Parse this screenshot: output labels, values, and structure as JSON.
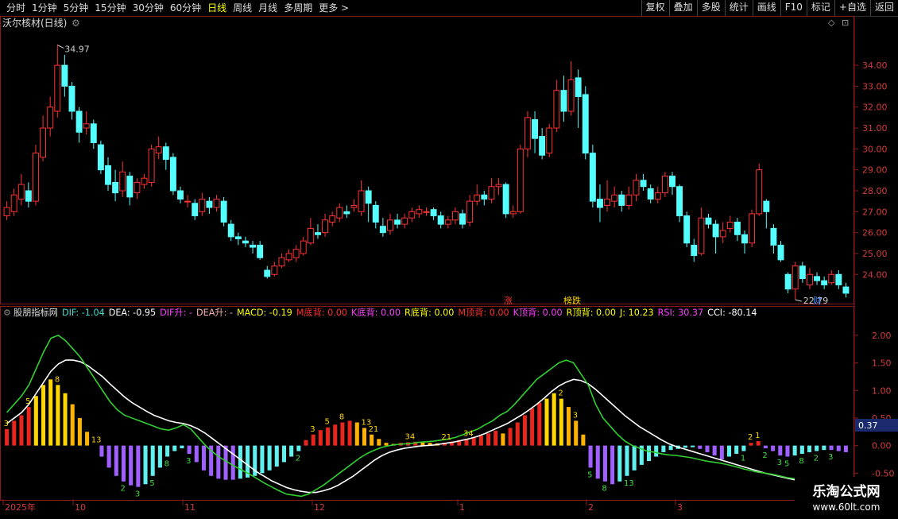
{
  "toolbar": {
    "periods": [
      "分时",
      "1分钟",
      "5分钟",
      "15分钟",
      "30分钟",
      "60分钟",
      "日线",
      "周线",
      "月线",
      "多周期",
      "更多 >"
    ],
    "active_period": "日线",
    "buttons": [
      "复权",
      "叠加",
      "多股",
      "统计",
      "画线",
      "F10",
      "标记",
      "+自选",
      "返回"
    ]
  },
  "stock": {
    "title": "沃尔核材(日线)",
    "high_label": "34.97",
    "low_label": "22.79",
    "markers": {
      "zhang": "涨",
      "bangdie": "榜跌",
      "cai": "财"
    }
  },
  "indicator": {
    "name": "股朋指标网",
    "values": [
      {
        "text": "DIF: -1.04",
        "color": "#40e0d0"
      },
      {
        "text": "DEA: -0.95",
        "color": "#ffffff"
      },
      {
        "text": "DIF升: -",
        "color": "#ff40ff"
      },
      {
        "text": "DEA升: -",
        "color": "#ffb0b0"
      },
      {
        "text": "MACD: -0.19",
        "color": "#ffff00"
      },
      {
        "text": "M底背: 0.00",
        "color": "#ff3030"
      },
      {
        "text": "K底背: 0.00",
        "color": "#ff40ff"
      },
      {
        "text": "R底背: 0.00",
        "color": "#ffff00"
      },
      {
        "text": "M顶背: 0.00",
        "color": "#ff3030"
      },
      {
        "text": "K顶背: 0.00",
        "color": "#ff40ff"
      },
      {
        "text": "R顶背: 0.00",
        "color": "#ffff00"
      },
      {
        "text": "J: 10.23",
        "color": "#ffff00"
      },
      {
        "text": "RSI: 30.37",
        "color": "#ff40ff"
      },
      {
        "text": "CCI: -80.14",
        "color": "#ffffff"
      }
    ],
    "current_value": "0.37"
  },
  "chart_data": [
    {
      "type": "candlestick",
      "title": "沃尔核材(日线)",
      "y_ticks": [
        24.0,
        25.0,
        26.0,
        27.0,
        28.0,
        29.0,
        30.0,
        31.0,
        32.0,
        33.0,
        34.0
      ],
      "ylim": [
        22.3,
        35.6
      ],
      "annotations": [
        "34.97",
        "22.79"
      ],
      "candles": [
        [
          26.8,
          27.2,
          27.5,
          26.6
        ],
        [
          27.0,
          27.8,
          28.1,
          26.8
        ],
        [
          27.6,
          28.3,
          28.8,
          27.3
        ],
        [
          28.0,
          27.5,
          28.4,
          27.2
        ],
        [
          27.5,
          29.8,
          30.2,
          27.3
        ],
        [
          29.6,
          31.0,
          31.6,
          29.4
        ],
        [
          31.0,
          32.0,
          32.5,
          30.6
        ],
        [
          31.8,
          34.0,
          34.97,
          31.5
        ],
        [
          34.0,
          33.0,
          34.5,
          32.5
        ],
        [
          33.0,
          31.8,
          33.2,
          31.4
        ],
        [
          31.8,
          30.8,
          32.0,
          30.3
        ],
        [
          31.0,
          31.2,
          31.8,
          30.7
        ],
        [
          31.2,
          30.3,
          31.4,
          30.0
        ],
        [
          30.2,
          29.0,
          30.4,
          28.8
        ],
        [
          29.2,
          28.3,
          29.6,
          28.0
        ],
        [
          28.4,
          27.9,
          29.0,
          27.5
        ],
        [
          28.0,
          28.9,
          29.4,
          27.7
        ],
        [
          28.7,
          27.7,
          28.9,
          27.3
        ],
        [
          27.9,
          28.4,
          28.6,
          27.6
        ],
        [
          28.3,
          28.6,
          28.8,
          28.1
        ],
        [
          28.4,
          30.0,
          30.2,
          28.2
        ],
        [
          29.8,
          30.1,
          30.6,
          29.5
        ],
        [
          30.1,
          29.5,
          30.3,
          29.0
        ],
        [
          29.6,
          28.0,
          29.8,
          27.8
        ],
        [
          28.0,
          27.6,
          28.2,
          27.4
        ],
        [
          27.5,
          27.5,
          27.8,
          27.2
        ],
        [
          27.4,
          26.8,
          27.6,
          26.6
        ],
        [
          27.0,
          27.6,
          27.9,
          26.8
        ],
        [
          27.5,
          27.2,
          27.7,
          26.9
        ],
        [
          27.2,
          27.6,
          27.8,
          27.0
        ],
        [
          27.5,
          26.5,
          27.7,
          26.3
        ],
        [
          26.4,
          25.8,
          26.6,
          25.6
        ],
        [
          25.8,
          25.7,
          26.0,
          25.4
        ],
        [
          25.6,
          25.5,
          25.8,
          25.3
        ],
        [
          25.4,
          25.3,
          25.6,
          25.0
        ],
        [
          25.4,
          24.8,
          25.6,
          24.7
        ],
        [
          24.2,
          23.9,
          24.4,
          23.8
        ],
        [
          24.0,
          24.4,
          24.6,
          23.9
        ],
        [
          24.4,
          24.8,
          25.0,
          24.3
        ],
        [
          24.7,
          25.0,
          25.2,
          24.6
        ],
        [
          24.8,
          25.2,
          25.4,
          24.6
        ],
        [
          25.0,
          25.6,
          25.8,
          24.9
        ],
        [
          25.5,
          26.2,
          26.7,
          25.4
        ],
        [
          26.0,
          25.9,
          26.4,
          25.7
        ],
        [
          26.0,
          26.6,
          26.9,
          25.8
        ],
        [
          26.5,
          26.8,
          27.0,
          26.3
        ],
        [
          26.7,
          27.2,
          27.4,
          26.5
        ],
        [
          27.0,
          26.9,
          27.3,
          26.7
        ],
        [
          27.2,
          27.3,
          27.6,
          27.0
        ],
        [
          27.0,
          28.0,
          28.5,
          26.8
        ],
        [
          28.0,
          27.4,
          28.2,
          26.5
        ],
        [
          27.3,
          26.5,
          27.5,
          26.2
        ],
        [
          26.3,
          26.0,
          26.7,
          25.8
        ],
        [
          26.1,
          26.6,
          26.9,
          25.9
        ],
        [
          26.6,
          26.4,
          26.9,
          26.2
        ],
        [
          26.4,
          26.7,
          26.9,
          26.2
        ],
        [
          26.7,
          27.0,
          27.2,
          26.5
        ],
        [
          26.9,
          27.1,
          27.3,
          26.7
        ],
        [
          27.0,
          27.0,
          27.2,
          26.8
        ],
        [
          27.1,
          26.8,
          27.2,
          26.6
        ],
        [
          26.8,
          26.4,
          27.0,
          26.2
        ],
        [
          26.4,
          26.6,
          26.8,
          26.2
        ],
        [
          26.6,
          27.0,
          27.2,
          26.4
        ],
        [
          26.9,
          26.4,
          27.1,
          26.2
        ],
        [
          26.5,
          27.5,
          27.8,
          26.3
        ],
        [
          27.5,
          27.8,
          28.3,
          27.3
        ],
        [
          27.8,
          27.6,
          28.0,
          27.3
        ],
        [
          27.6,
          28.2,
          28.6,
          27.4
        ],
        [
          28.2,
          28.3,
          28.6,
          27.8
        ],
        [
          28.3,
          26.9,
          28.4,
          26.7
        ],
        [
          26.9,
          27.0,
          27.3,
          26.7
        ],
        [
          27.0,
          30.0,
          30.2,
          26.9
        ],
        [
          30.0,
          31.5,
          31.8,
          29.6
        ],
        [
          31.4,
          30.5,
          31.8,
          29.8
        ],
        [
          30.6,
          29.7,
          31.0,
          29.5
        ],
        [
          29.8,
          31.0,
          31.2,
          29.6
        ],
        [
          31.0,
          32.8,
          33.3,
          30.8
        ],
        [
          32.8,
          31.8,
          33.5,
          31.3
        ],
        [
          31.8,
          33.3,
          34.2,
          31.6
        ],
        [
          33.4,
          32.5,
          33.8,
          31.0
        ],
        [
          32.6,
          29.8,
          33.0,
          29.5
        ],
        [
          29.8,
          27.5,
          30.2,
          27.2
        ],
        [
          27.6,
          27.2,
          28.3,
          26.5
        ],
        [
          27.3,
          27.6,
          28.5,
          27.0
        ],
        [
          27.5,
          27.8,
          28.2,
          27.2
        ],
        [
          27.8,
          27.3,
          28.0,
          27.0
        ],
        [
          27.3,
          27.8,
          28.2,
          27.1
        ],
        [
          27.8,
          28.5,
          28.8,
          27.5
        ],
        [
          28.5,
          28.2,
          28.8,
          28.0
        ],
        [
          28.1,
          27.6,
          28.3,
          27.4
        ],
        [
          27.6,
          27.9,
          28.2,
          27.4
        ],
        [
          27.9,
          28.7,
          28.9,
          27.7
        ],
        [
          28.7,
          28.2,
          28.9,
          27.8
        ],
        [
          28.2,
          26.8,
          28.3,
          26.5
        ],
        [
          26.8,
          25.5,
          27.0,
          25.3
        ],
        [
          25.4,
          24.9,
          25.7,
          24.6
        ],
        [
          25.0,
          26.7,
          27.2,
          24.9
        ],
        [
          26.7,
          26.4,
          26.9,
          26.2
        ],
        [
          26.4,
          25.8,
          26.6,
          25.0
        ],
        [
          25.8,
          26.1,
          26.5,
          25.5
        ],
        [
          26.2,
          26.5,
          26.8,
          26.0
        ],
        [
          26.5,
          25.9,
          26.7,
          25.6
        ],
        [
          25.9,
          25.5,
          26.1,
          25.0
        ],
        [
          25.5,
          26.9,
          27.1,
          25.3
        ],
        [
          26.9,
          29.0,
          29.3,
          26.8
        ],
        [
          27.5,
          27.0,
          27.6,
          26.2
        ],
        [
          26.2,
          25.4,
          26.4,
          25.0
        ],
        [
          25.4,
          24.7,
          25.6,
          24.6
        ],
        [
          24.0,
          23.3,
          24.1,
          23.1
        ],
        [
          23.3,
          24.4,
          24.6,
          22.79
        ],
        [
          24.4,
          23.8,
          24.6,
          23.6
        ],
        [
          23.5,
          24.0,
          24.3,
          23.3
        ],
        [
          23.9,
          23.7,
          24.1,
          23.5
        ],
        [
          23.7,
          23.5,
          23.9,
          23.3
        ],
        [
          23.6,
          24.0,
          24.2,
          23.5
        ],
        [
          24.0,
          23.5,
          24.2,
          23.3
        ],
        [
          23.4,
          23.1,
          23.6,
          22.9
        ]
      ]
    },
    {
      "type": "macd",
      "title": "股朋指标网",
      "y_ticks": [
        2.0,
        1.5,
        1.0,
        0.5,
        0.0,
        -0.5
      ],
      "ylim": [
        -1.0,
        2.2
      ],
      "x_labels": [
        "2025年",
        "10",
        "11",
        "12",
        "1",
        "2",
        "3"
      ],
      "histogram_labels": [
        "3",
        "5",
        "8",
        "13",
        "2",
        "3",
        "5",
        "8",
        "3",
        "21",
        "34",
        "2",
        "3",
        "5",
        "8",
        "13",
        "21",
        "34",
        "2",
        "3",
        "5",
        "8",
        "13",
        "1",
        "2",
        "1",
        "2",
        "3",
        "5",
        "8",
        "2",
        "3"
      ],
      "hist": [
        0.3,
        0.45,
        0.55,
        0.7,
        0.9,
        1.1,
        1.2,
        1.1,
        0.95,
        0.75,
        0.5,
        0.25,
        0.0,
        -0.2,
        -0.4,
        -0.55,
        -0.65,
        -0.72,
        -0.75,
        -0.7,
        -0.55,
        -0.4,
        -0.2,
        -0.1,
        -0.05,
        -0.15,
        -0.3,
        -0.45,
        -0.55,
        -0.6,
        -0.62,
        -0.62,
        -0.6,
        -0.58,
        -0.55,
        -0.5,
        -0.45,
        -0.38,
        -0.3,
        -0.2,
        -0.1,
        0.1,
        0.2,
        0.28,
        0.33,
        0.38,
        0.42,
        0.45,
        0.42,
        0.32,
        0.2,
        0.12,
        0.05,
        0.03,
        0.05,
        0.06,
        0.07,
        0.06,
        0.05,
        0.04,
        0.05,
        0.07,
        0.1,
        0.12,
        0.15,
        0.18,
        0.22,
        0.27,
        0.22,
        0.32,
        0.42,
        0.55,
        0.68,
        0.78,
        0.85,
        0.95,
        0.85,
        0.7,
        0.45,
        0.2,
        -0.4,
        -0.6,
        -0.65,
        -0.7,
        -0.65,
        -0.55,
        -0.45,
        -0.35,
        -0.28,
        -0.2,
        -0.12,
        -0.08,
        -0.06,
        -0.04,
        -0.03,
        -0.06,
        -0.12,
        -0.18,
        -0.25,
        -0.2,
        -0.15,
        -0.1,
        0.05,
        0.08,
        -0.05,
        -0.1,
        -0.18,
        -0.2,
        -0.18,
        -0.15,
        -0.12,
        -0.1,
        -0.08,
        -0.08,
        -0.1,
        -0.12
      ],
      "dif": [
        0.6,
        0.75,
        0.9,
        1.1,
        1.4,
        1.7,
        1.95,
        2.0,
        1.9,
        1.75,
        1.6,
        1.4,
        1.2,
        1.0,
        0.8,
        0.65,
        0.55,
        0.5,
        0.45,
        0.4,
        0.35,
        0.3,
        0.28,
        0.32,
        0.38,
        0.3,
        0.15,
        0.0,
        -0.12,
        -0.22,
        -0.3,
        -0.38,
        -0.45,
        -0.52,
        -0.6,
        -0.68,
        -0.75,
        -0.82,
        -0.88,
        -0.9,
        -0.92,
        -0.88,
        -0.8,
        -0.72,
        -0.62,
        -0.52,
        -0.42,
        -0.32,
        -0.22,
        -0.14,
        -0.08,
        -0.03,
        0.0,
        0.02,
        0.03,
        0.04,
        0.06,
        0.07,
        0.08,
        0.1,
        0.12,
        0.15,
        0.2,
        0.25,
        0.3,
        0.38,
        0.45,
        0.55,
        0.62,
        0.75,
        0.9,
        1.05,
        1.2,
        1.3,
        1.4,
        1.5,
        1.55,
        1.5,
        1.3,
        1.1,
        0.75,
        0.5,
        0.35,
        0.2,
        0.08,
        0.0,
        -0.05,
        -0.1,
        -0.12,
        -0.15,
        -0.17,
        -0.18,
        -0.2,
        -0.22,
        -0.25,
        -0.28,
        -0.3,
        -0.32,
        -0.35,
        -0.38,
        -0.42,
        -0.45,
        -0.48,
        -0.5,
        -0.52,
        -0.55,
        -0.58,
        -0.6,
        -0.62,
        -0.65,
        -0.7,
        -0.78,
        -0.9,
        -1.0,
        -1.04
      ],
      "dea": [
        0.4,
        0.5,
        0.6,
        0.75,
        0.95,
        1.15,
        1.35,
        1.48,
        1.55,
        1.55,
        1.52,
        1.45,
        1.35,
        1.25,
        1.12,
        1.0,
        0.88,
        0.78,
        0.7,
        0.62,
        0.55,
        0.5,
        0.45,
        0.42,
        0.4,
        0.36,
        0.3,
        0.22,
        0.12,
        0.02,
        -0.08,
        -0.18,
        -0.28,
        -0.38,
        -0.48,
        -0.56,
        -0.64,
        -0.7,
        -0.76,
        -0.8,
        -0.83,
        -0.85,
        -0.85,
        -0.82,
        -0.78,
        -0.72,
        -0.64,
        -0.56,
        -0.46,
        -0.36,
        -0.26,
        -0.18,
        -0.12,
        -0.08,
        -0.05,
        -0.03,
        -0.01,
        0.0,
        0.01,
        0.03,
        0.05,
        0.07,
        0.1,
        0.13,
        0.17,
        0.22,
        0.28,
        0.34,
        0.4,
        0.48,
        0.56,
        0.65,
        0.75,
        0.86,
        0.98,
        1.08,
        1.15,
        1.2,
        1.18,
        1.12,
        1.02,
        0.9,
        0.78,
        0.66,
        0.54,
        0.44,
        0.34,
        0.26,
        0.18,
        0.1,
        0.03,
        -0.02,
        -0.06,
        -0.1,
        -0.14,
        -0.18,
        -0.22,
        -0.26,
        -0.3,
        -0.34,
        -0.38,
        -0.42,
        -0.46,
        -0.5,
        -0.53,
        -0.56,
        -0.59,
        -0.62,
        -0.65,
        -0.68,
        -0.72,
        -0.78,
        -0.86,
        -0.92,
        -0.95
      ]
    }
  ]
}
